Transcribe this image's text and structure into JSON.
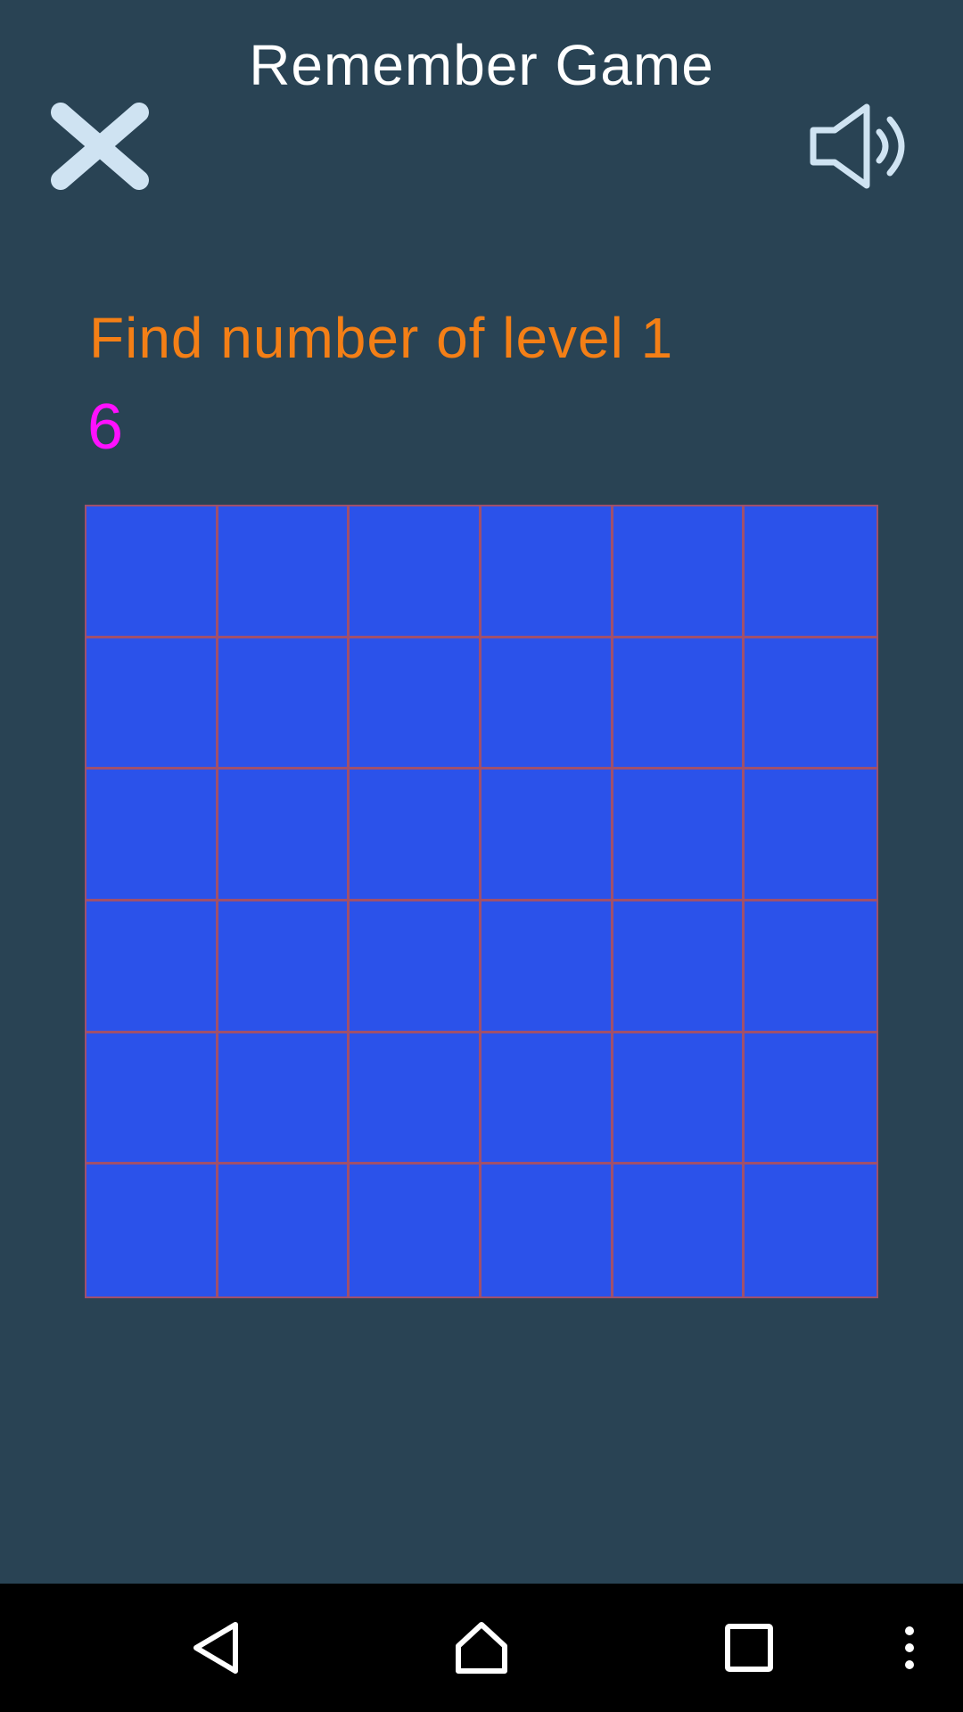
{
  "header": {
    "title": "Remember Game",
    "close_icon": "close-icon",
    "sound_icon": "speaker-sound-on-icon"
  },
  "game": {
    "instruction": "Find number of level 1",
    "target_number": "6",
    "grid_rows": 6,
    "grid_cols": 6,
    "tile_color": "#2b52ea",
    "grid_line_color": "#a0506c"
  },
  "colors": {
    "background": "#294354",
    "instruction": "#f47f16",
    "target_number": "#ff10ff",
    "icon": "#cfe3f2"
  },
  "navbar": {
    "icons": [
      "back-icon",
      "home-icon",
      "recents-icon",
      "overflow-menu-icon"
    ]
  }
}
